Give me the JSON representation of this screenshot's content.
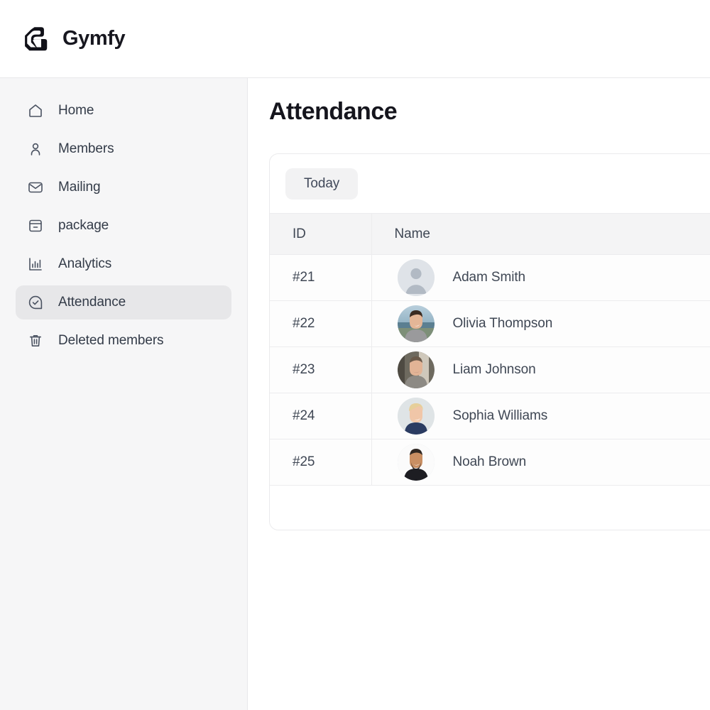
{
  "app": {
    "brand_name": "Gymfy",
    "logo_icon": "gymfy-flex-logo"
  },
  "sidebar": {
    "items": [
      {
        "label": "Home",
        "icon": "home-icon",
        "active": false
      },
      {
        "label": "Members",
        "icon": "user-icon",
        "active": false
      },
      {
        "label": "Mailing",
        "icon": "envelope-icon",
        "active": false
      },
      {
        "label": "package",
        "icon": "box-icon",
        "active": false
      },
      {
        "label": "Analytics",
        "icon": "bar-chart-icon",
        "active": false
      },
      {
        "label": "Attendance",
        "icon": "check-circle-icon",
        "active": true
      },
      {
        "label": "Deleted members",
        "icon": "trash-icon",
        "active": false
      }
    ]
  },
  "main": {
    "page_title": "Attendance",
    "toolbar": {
      "today_label": "Today"
    },
    "table": {
      "columns": [
        "ID",
        "Name"
      ],
      "rows": [
        {
          "id": "#21",
          "name": "Adam Smith",
          "avatar": "placeholder"
        },
        {
          "id": "#22",
          "name": "Olivia Thompson",
          "avatar": "photo-outdoor-lake"
        },
        {
          "id": "#23",
          "name": "Liam Johnson",
          "avatar": "photo-man-beard-light"
        },
        {
          "id": "#24",
          "name": "Sophia Williams",
          "avatar": "photo-woman-blonde"
        },
        {
          "id": "#25",
          "name": "Noah Brown",
          "avatar": "photo-man-smiling-dark-shirt"
        }
      ]
    }
  },
  "colors": {
    "page_bg": "#ffffff",
    "sidebar_bg": "#f6f6f7",
    "active_item_bg": "#e7e7e9",
    "chip_bg": "#f2f2f3",
    "table_header_bg": "#f4f4f5",
    "border": "#ececee",
    "text_primary": "#15151d",
    "text_body": "#3f4754"
  }
}
